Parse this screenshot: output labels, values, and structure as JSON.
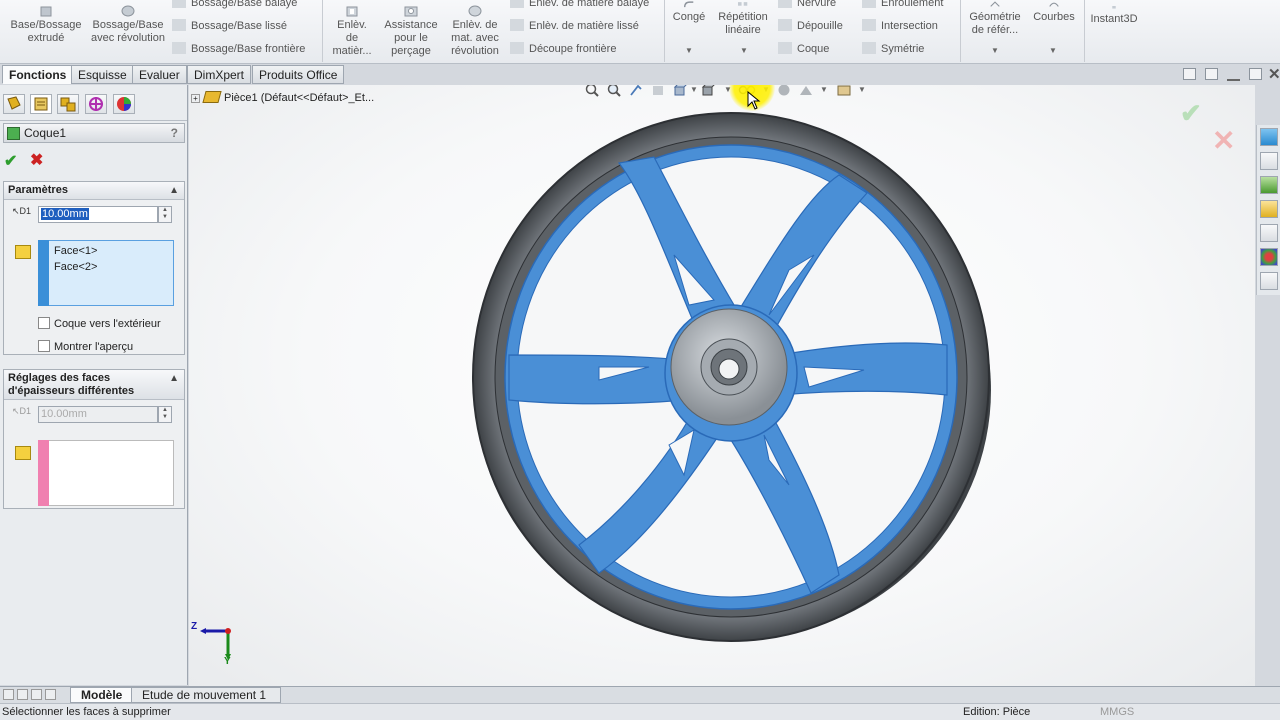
{
  "ribbon": {
    "big_buttons": [
      {
        "label": "Base/Bossage extrudé",
        "icon": "extruded-boss-icon"
      },
      {
        "label": "Bossage/Base avec révolution",
        "icon": "revolved-boss-icon"
      },
      {
        "label": "Enlèv. de matièr...",
        "icon": "extruded-cut-icon"
      },
      {
        "label": "Assistance pour le perçage",
        "icon": "hole-wizard-icon"
      },
      {
        "label": "Enlèv. de mat. avec révolution",
        "icon": "revolved-cut-icon"
      },
      {
        "label": "Congé",
        "icon": "fillet-icon"
      },
      {
        "label": "Répétition linéaire",
        "icon": "linear-pattern-icon"
      },
      {
        "label": "Géométrie de référ...",
        "icon": "reference-geometry-icon"
      },
      {
        "label": "Courbes",
        "icon": "curves-icon"
      },
      {
        "label": "Instant3D",
        "icon": "instant3d-icon"
      }
    ],
    "small_buttons": [
      {
        "label": "Bossage/Base balayé",
        "icon": "swept-boss-icon"
      },
      {
        "label": "Bossage/Base lissé",
        "icon": "lofted-boss-icon"
      },
      {
        "label": "Bossage/Base frontière",
        "icon": "boundary-boss-icon"
      },
      {
        "label": "Enlèv. de matière balayé",
        "icon": "swept-cut-icon"
      },
      {
        "label": "Enlèv. de matière lissé",
        "icon": "lofted-cut-icon"
      },
      {
        "label": "Découpe frontière",
        "icon": "boundary-cut-icon"
      },
      {
        "label": "Nervure",
        "icon": "rib-icon"
      },
      {
        "label": "Dépouille",
        "icon": "draft-icon"
      },
      {
        "label": "Coque",
        "icon": "shell-icon"
      },
      {
        "label": "Enroulement",
        "icon": "wrap-icon"
      },
      {
        "label": "Intersection",
        "icon": "intersect-icon"
      },
      {
        "label": "Symétrie",
        "icon": "mirror-icon"
      }
    ]
  },
  "tabs": [
    "Fonctions",
    "Esquisse",
    "Evaluer",
    "DimXpert",
    "Produits Office"
  ],
  "panel": {
    "feature_title": "Coque1",
    "help": "?",
    "params_header": "Paramètres",
    "thickness_value": "10.00mm",
    "faces": [
      "Face<1>",
      "Face<2>"
    ],
    "shell_outward": "Coque vers l'extérieur",
    "show_preview": "Montrer l'aperçu",
    "multi_header": "Réglages des faces d'épaisseurs différentes",
    "multi_thickness_value": "10.00mm",
    "dim_icon_label": "D1"
  },
  "viewport": {
    "tree_root": "Pièce1  (Défaut<<Défaut>_Et..."
  },
  "triad": {
    "z": "Z",
    "y": "Y"
  },
  "bottom_tabs": [
    "Modèle",
    "Etude de mouvement 1"
  ],
  "status": {
    "message": "Sélectionner les faces à supprimer",
    "units": "MMGS",
    "mode": "Edition: Pièce"
  },
  "colors": {
    "selection_blue": "#3a8fd8",
    "wheel_blue": "#4a8fd6",
    "tire_gray": "#555a60",
    "accept_green": "#2e9e2e",
    "cancel_red": "#cc2222"
  }
}
